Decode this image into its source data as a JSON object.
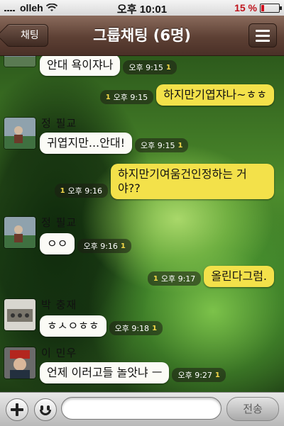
{
  "status_bar": {
    "carrier": "olleh",
    "time": "오후 10:01",
    "battery_percent_label": "15 %",
    "battery_level": 0.15
  },
  "nav": {
    "back_label": "채팅",
    "title": "그룹채팅 (6명)",
    "menu_icon": "menu-icon"
  },
  "messages": [
    {
      "direction": "in",
      "sender": "",
      "text": "안대 욕이쟈나",
      "time": "오후 9:15",
      "unread": "1"
    },
    {
      "direction": "out",
      "text": "하지만기엽쟈나~ㅎㅎ",
      "time": "오후 9:15",
      "unread": "1"
    },
    {
      "direction": "in",
      "sender": "정 필교",
      "text": "귀엽지만...안대!",
      "time": "오후 9:15",
      "unread": "1"
    },
    {
      "direction": "out",
      "text": "하지만기여움건인정하는 거야??",
      "time": "오후 9:16",
      "unread": "1"
    },
    {
      "direction": "in",
      "sender": "정 필교",
      "text": "ㅇㅇ",
      "time": "오후 9:16",
      "unread": "1"
    },
    {
      "direction": "out",
      "text": "올린다그럼.",
      "time": "오후 9:17",
      "unread": "1"
    },
    {
      "direction": "in",
      "sender": "박 충재",
      "text": "ㅎㅅㅇㅎㅎ",
      "time": "오후 9:18",
      "unread": "1"
    },
    {
      "direction": "in",
      "sender": "이 민우",
      "text": "언제 이러고들 놀앗냐 ㅡ",
      "time": "오후 9:27",
      "unread": "1"
    }
  ],
  "input_bar": {
    "plus_icon": "plus-icon",
    "emoji_icon": "emoji-icon",
    "text_value": "",
    "send_label": "전송"
  },
  "colors": {
    "outgoing_bubble": "#f3e14a",
    "incoming_bubble": "#fbfbf6",
    "navbar": "#5d4034",
    "battery_low": "#d01020"
  }
}
